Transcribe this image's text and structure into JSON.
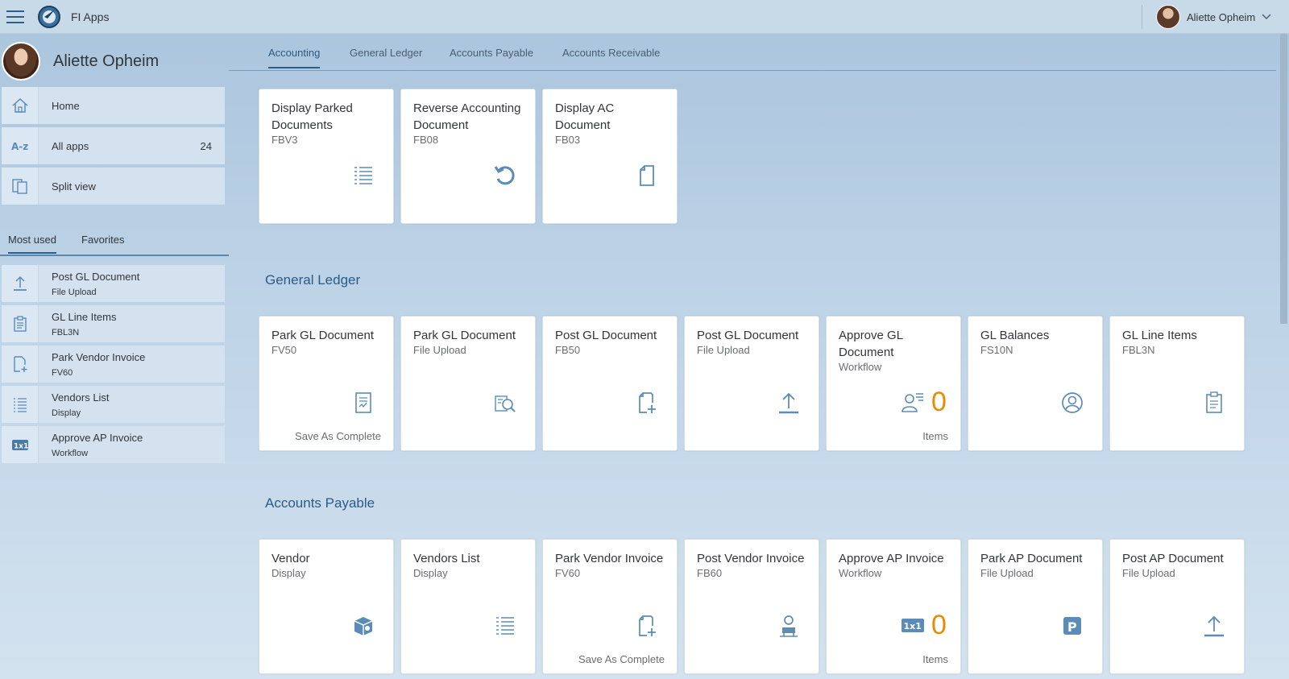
{
  "shell": {
    "app_title": "FI Apps",
    "user_name": "Aliette Opheim"
  },
  "me_area": {
    "user_name": "Aliette Opheim",
    "nav": [
      {
        "label": "Home",
        "icon": "home-icon"
      },
      {
        "label": "All apps",
        "icon": "a-z-icon",
        "count": "24"
      },
      {
        "label": "Split view",
        "icon": "split-view-icon"
      }
    ],
    "tabs": [
      {
        "label": "Most used"
      },
      {
        "label": "Favorites"
      }
    ],
    "most_used": [
      {
        "title": "Post GL Document",
        "subtitle": "File Upload",
        "icon": "upload-icon"
      },
      {
        "title": "GL Line Items",
        "subtitle": "FBL3N",
        "icon": "clipboard-icon"
      },
      {
        "title": "Park Vendor Invoice",
        "subtitle": "FV60",
        "icon": "add-document-icon"
      },
      {
        "title": "Vendors List",
        "subtitle": "Display",
        "icon": "list-icon"
      },
      {
        "title": "Approve AP Invoice",
        "subtitle": "Workflow",
        "icon": "one-x-one-icon"
      }
    ]
  },
  "anchor_bar": [
    {
      "label": "Accounting"
    },
    {
      "label": "General Ledger"
    },
    {
      "label": "Accounts Payable"
    },
    {
      "label": "Accounts Receivable"
    }
  ],
  "groups": {
    "accounting": {
      "tiles": [
        {
          "title": "Display Parked Documents",
          "subtitle": "FBV3",
          "icon": "list-icon"
        },
        {
          "title": "Reverse Accounting Document",
          "subtitle": "FB08",
          "icon": "undo-icon"
        },
        {
          "title": "Display AC Document",
          "subtitle": "FB03",
          "icon": "document-icon"
        }
      ]
    },
    "general_ledger": {
      "title": "General Ledger",
      "tiles": [
        {
          "title": "Park GL Document",
          "subtitle": "FV50",
          "icon": "form-icon",
          "footer": "Save As Complete"
        },
        {
          "title": "Park GL Document",
          "subtitle": "File Upload",
          "icon": "search-documents-icon"
        },
        {
          "title": "Post GL Document",
          "subtitle": "FB50",
          "icon": "add-document-icon"
        },
        {
          "title": "Post GL Document",
          "subtitle": "File Upload",
          "icon": "upload-icon"
        },
        {
          "title": "Approve GL Document",
          "subtitle": "Workflow",
          "icon": "person-list-icon",
          "kpi": "0",
          "footer": "Items"
        },
        {
          "title": "GL Balances",
          "subtitle": "FS10N",
          "icon": "person-circle-icon"
        },
        {
          "title": "GL Line Items",
          "subtitle": "FBL3N",
          "icon": "clipboard-icon"
        }
      ]
    },
    "accounts_payable": {
      "title": "Accounts Payable",
      "tiles": [
        {
          "title": "Vendor",
          "subtitle": "Display",
          "icon": "supplier-box-icon"
        },
        {
          "title": "Vendors List",
          "subtitle": "Display",
          "icon": "list-icon"
        },
        {
          "title": "Park Vendor Invoice",
          "subtitle": "FV60",
          "icon": "add-document-icon",
          "footer": "Save As Complete"
        },
        {
          "title": "Post Vendor Invoice",
          "subtitle": "FB60",
          "icon": "supplier-icon"
        },
        {
          "title": "Approve AP Invoice",
          "subtitle": "Workflow",
          "icon": "one-x-one-icon",
          "kpi": "0",
          "footer": "Items"
        },
        {
          "title": "Park AP Document",
          "subtitle": "File Upload",
          "icon": "parking-icon"
        },
        {
          "title": "Post AP Document",
          "subtitle": "File Upload",
          "icon": "upload-icon"
        }
      ]
    }
  },
  "colors": {
    "accent": "#2e5f8a",
    "kpi": "#e78c07",
    "icon": "#5b8cb8"
  }
}
